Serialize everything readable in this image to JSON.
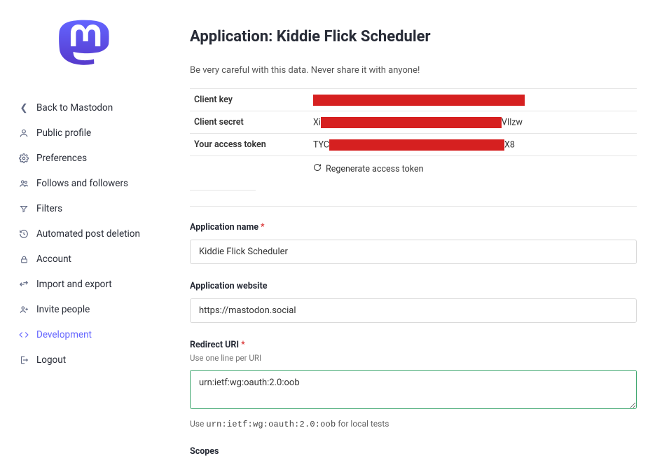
{
  "sidebar": {
    "items": [
      {
        "icon": "chevron-left",
        "label": "Back to Mastodon"
      },
      {
        "icon": "person",
        "label": "Public profile"
      },
      {
        "icon": "gear",
        "label": "Preferences"
      },
      {
        "icon": "group",
        "label": "Follows and followers"
      },
      {
        "icon": "filter",
        "label": "Filters"
      },
      {
        "icon": "history",
        "label": "Automated post deletion"
      },
      {
        "icon": "lock",
        "label": "Account"
      },
      {
        "icon": "transfer",
        "label": "Import and export"
      },
      {
        "icon": "invite",
        "label": "Invite people"
      },
      {
        "icon": "code",
        "label": "Development",
        "active": true
      },
      {
        "icon": "logout",
        "label": "Logout"
      }
    ]
  },
  "header": {
    "title": "Application: Kiddie Flick Scheduler",
    "warning": "Be very careful with this data. Never share it with anyone!"
  },
  "credentials": {
    "client_key_label": "Client key",
    "client_key_prefix": "",
    "client_key_suffix": "",
    "client_secret_label": "Client secret",
    "client_secret_prefix": "Xi",
    "client_secret_suffix": "VIlzw",
    "access_token_label": "Your access token",
    "access_token_prefix": "TYC",
    "access_token_suffix": "X8",
    "regenerate_label": "Regenerate access token"
  },
  "form": {
    "app_name_label": "Application name",
    "app_name_value": "Kiddie Flick Scheduler",
    "app_website_label": "Application website",
    "app_website_value": "https://mastodon.social",
    "redirect_label": "Redirect URI",
    "redirect_hint": "Use one line per URI",
    "redirect_value": "urn:ietf:wg:oauth:2.0:oob",
    "local_hint_prefix": "Use ",
    "local_hint_code": "urn:ietf:wg:oauth:2.0:oob",
    "local_hint_suffix": " for local tests",
    "scopes_label": "Scopes"
  }
}
